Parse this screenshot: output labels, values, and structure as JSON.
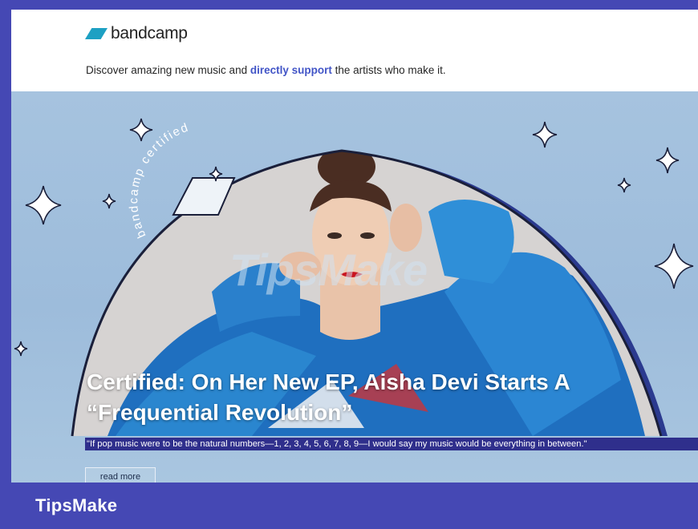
{
  "header": {
    "logo_text": "bandcamp",
    "tagline_pre": "Discover amazing new music and ",
    "tagline_highlight": "directly support",
    "tagline_post": " the artists who make it."
  },
  "hero": {
    "badge_text": "bandcamp certified",
    "watermark": "TipsMake",
    "title_line1": "Certified: On Her New EP, Aisha Devi Starts A",
    "title_line2": "“Frequential Revolution”",
    "quote": "\"If pop music were to be the natural numbers—1, 2, 3, 4, 5, 6, 7, 8, 9—I would say my music would be everything in between.\"",
    "read_more_label": "read more"
  },
  "footer": {
    "brand": "TipsMake"
  },
  "colors": {
    "frame": "#4548b4",
    "logo_accent": "#1da0c3",
    "highlight_link": "#4255c7",
    "hero_bg": "#a6c3df",
    "quote_bg": "#2f2f8c"
  }
}
